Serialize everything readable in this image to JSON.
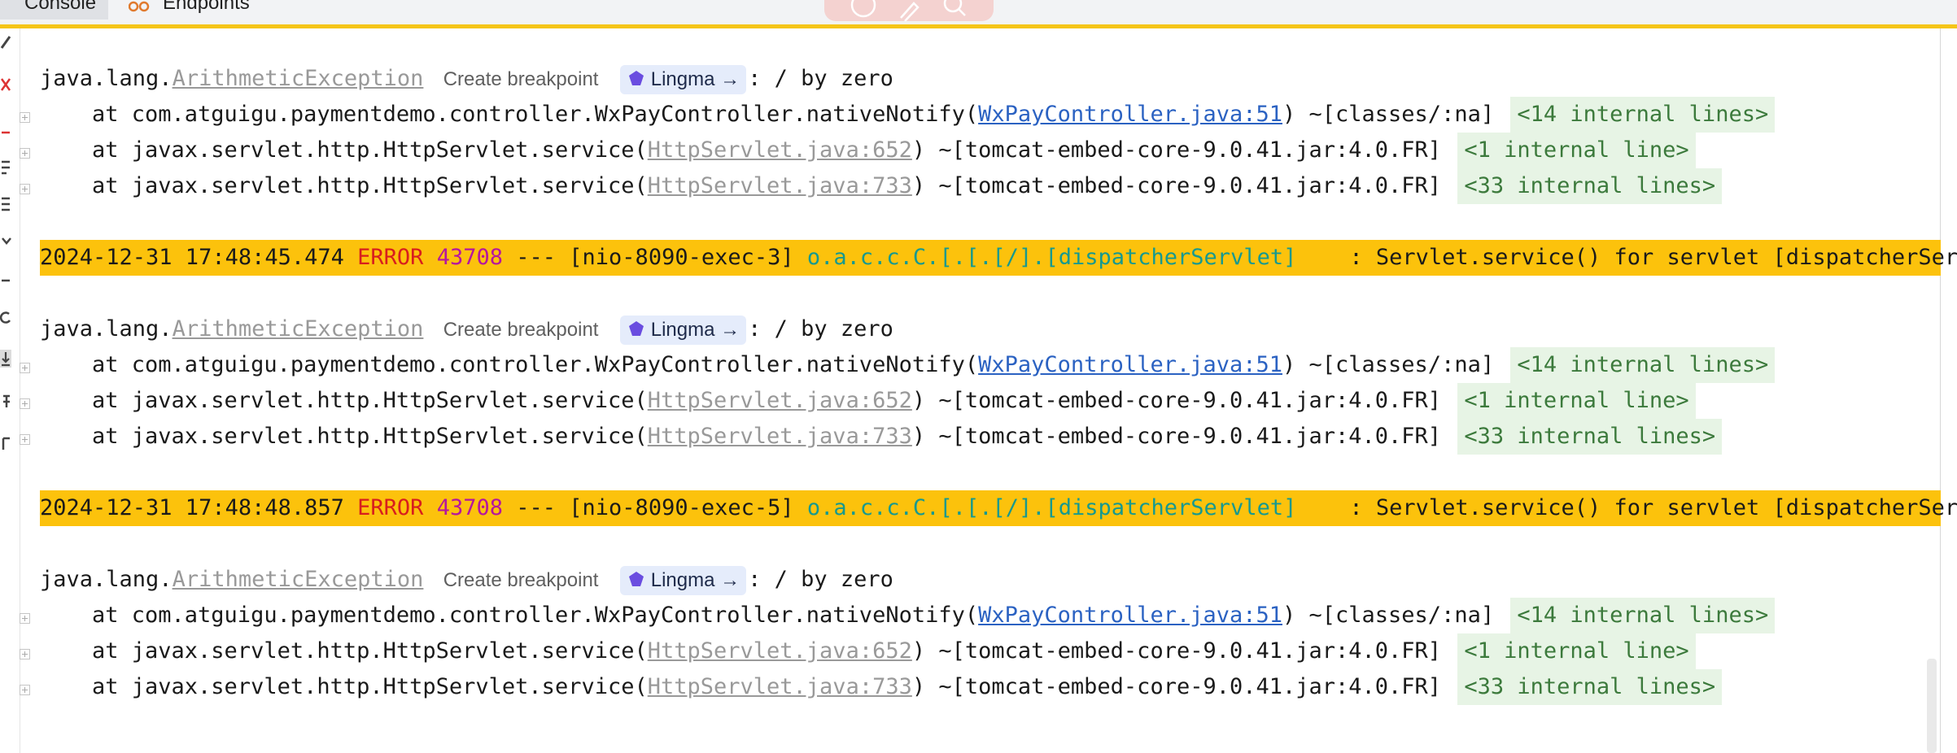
{
  "tabs": {
    "console": "Console",
    "endpoints": "Endpoints"
  },
  "log": {
    "stack_common": {
      "exception_prefix": "java.lang.",
      "exception_class": "ArithmeticException",
      "create_breakpoint": "Create breakpoint",
      "lingma_label": "Lingma →",
      "message": ": / by zero",
      "frames": [
        {
          "prefix": "at com.atguigu.paymentdemo.controller.WxPayController.nativeNotify(",
          "link": "WxPayController.java:51",
          "suffix": ") ~[classes/:na]",
          "folded": "<14 internal lines>"
        },
        {
          "prefix": "at javax.servlet.http.HttpServlet.service(",
          "link": "HttpServlet.java:652",
          "suffix": ") ~[tomcat-embed-core-9.0.41.jar:4.0.FR]",
          "folded": "<1 internal line>"
        },
        {
          "prefix": "at javax.servlet.http.HttpServlet.service(",
          "link": "HttpServlet.java:733",
          "suffix": ") ~[tomcat-embed-core-9.0.41.jar:4.0.FR]",
          "folded": "<33 internal lines>"
        }
      ]
    },
    "error_lines": [
      {
        "timestamp": "2024-12-31 17:48:45.474",
        "level": "ERROR",
        "pid": "43708",
        "sep": "---",
        "thread": "[nio-8090-exec-3]",
        "logger": "o.a.c.c.C.[.[.[/].[dispatcherServlet]",
        "message": ": Servlet.service() for servlet [dispatcherServ"
      },
      {
        "timestamp": "2024-12-31 17:48:48.857",
        "level": "ERROR",
        "pid": "43708",
        "sep": "---",
        "thread": "[nio-8090-exec-5]",
        "logger": "o.a.c.c.C.[.[.[/].[dispatcherServlet]",
        "message": ": Servlet.service() for servlet [dispatcherServ"
      }
    ]
  },
  "colors": {
    "error_band": "#fcc20c",
    "error_level": "#d81e1e",
    "pid": "#b5179e",
    "logger": "#16998f",
    "link": "#2b62c2",
    "internal_bg": "#e7f4e5"
  }
}
